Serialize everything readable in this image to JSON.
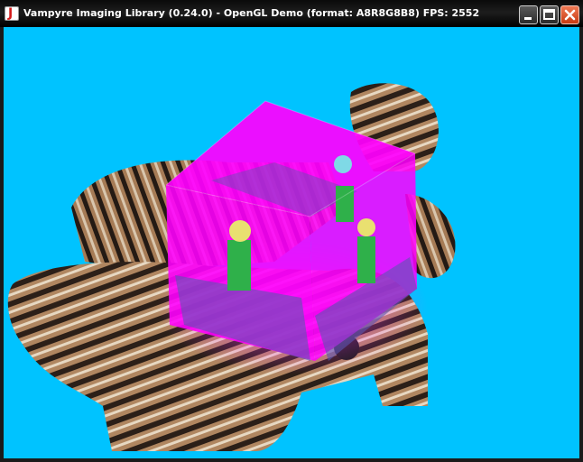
{
  "window": {
    "title": "Vampyre Imaging Library (0.24.0) - OpenGL Demo (format: A8R8G8B8) FPS: 2552",
    "icon_letter": "J",
    "icon": "app-logo-icon",
    "buttons": {
      "minimize_icon": "minimize-icon",
      "maximize_icon": "maximize-icon",
      "close_icon": "close-icon"
    }
  },
  "scene": {
    "background_color": "#00c3ff",
    "cube_color": "#ff00ff"
  }
}
